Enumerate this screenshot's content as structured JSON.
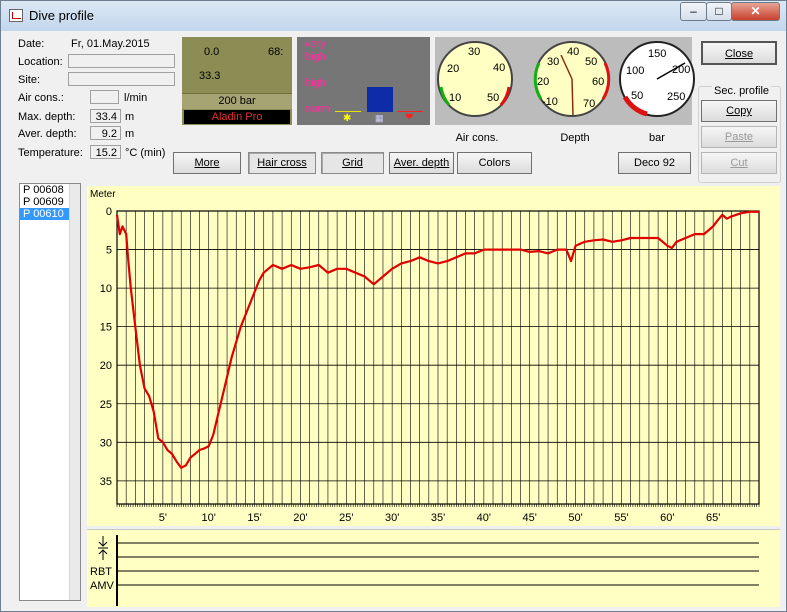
{
  "window": {
    "title": "Dive profile"
  },
  "info": {
    "date_label": "Date:",
    "date_value": "Fr, 01.May.2015",
    "location_label": "Location:",
    "location_value": "",
    "site_label": "Site:",
    "site_value": "",
    "aircons_label": "Air cons.:",
    "aircons_value": "",
    "aircons_unit": "l/min",
    "maxdepth_label": "Max. depth:",
    "maxdepth_value": "33.4",
    "maxdepth_unit": "m",
    "averdepth_label": "Aver. depth:",
    "averdepth_value": "9.2",
    "averdepth_unit": "m",
    "temp_label": "Temperature:",
    "temp_value": "15.2",
    "temp_unit": "°C  (min)"
  },
  "lcd": {
    "left": "0.0",
    "right": "68:",
    "depth": "33.3",
    "pressure": "200 bar",
    "model": "Aladin Pro"
  },
  "workload": {
    "very": "very",
    "high_1": "high",
    "high_2": "high",
    "norm": "norm",
    "level_color": "#0e2ca8"
  },
  "gauges": [
    {
      "name": "Air cons.",
      "ticks": [
        "10",
        "20",
        "30",
        "40",
        "50"
      ]
    },
    {
      "name": "Depth",
      "ticks": [
        "-10",
        "20",
        "30",
        "40",
        "50",
        "60",
        "70"
      ]
    },
    {
      "name": "bar",
      "ticks": [
        "50",
        "100",
        "150",
        "200",
        "250"
      ]
    }
  ],
  "buttons": {
    "more": "More",
    "haircross": "Hair cross",
    "grid": "Grid",
    "averdepth": "Aver. depth",
    "colors": "Colors",
    "deco": "Deco 92",
    "close": "Close",
    "copy": "Copy",
    "paste": "Paste",
    "cut": "Cut"
  },
  "secprofile": {
    "label": "Sec. profile"
  },
  "profiles": [
    "P 00608",
    "P 00609",
    "P 00610"
  ],
  "selected_profile": 2,
  "bottom_labels": [
    "RBT",
    "AMV"
  ],
  "colors": {
    "profile_line": "#e00000",
    "chart_bg": "#ffffc4",
    "accent": "#3399ff"
  },
  "chart_data": {
    "type": "line",
    "ylabel": "Meter",
    "y_inverted": true,
    "ylim": [
      0,
      38
    ],
    "xlim": [
      0,
      70
    ],
    "y_ticks": [
      "0",
      "5",
      "10",
      "15",
      "20",
      "25",
      "30",
      "35"
    ],
    "x_ticks": [
      "5'",
      "10'",
      "15'",
      "20'",
      "25'",
      "30'",
      "35'",
      "40'",
      "45'",
      "50'",
      "55'",
      "60'",
      "65'"
    ],
    "x_tick_values": [
      5,
      10,
      15,
      20,
      25,
      30,
      35,
      40,
      45,
      50,
      55,
      60,
      65
    ],
    "grid": true,
    "series": [
      {
        "values_x": [
          0,
          0.3,
          0.6,
          1,
          1.2,
          1.5,
          2,
          2.5,
          3,
          3.5,
          4,
          4.5,
          5,
          5.5,
          6,
          6.5,
          7,
          7.5,
          8,
          8.5,
          9,
          9.5,
          10,
          10.5,
          11,
          11.5,
          12,
          12.5,
          13,
          13.5,
          14,
          14.5,
          15,
          15.5,
          16,
          16.5,
          17,
          18,
          19,
          20,
          21,
          22,
          23,
          24,
          25,
          26,
          27,
          28,
          29,
          30,
          31,
          32,
          33,
          34,
          35,
          36,
          37,
          38,
          39,
          40,
          41,
          42,
          43,
          44,
          45,
          46,
          47,
          48,
          49,
          49.5,
          50,
          51,
          52,
          53,
          54,
          55,
          56,
          57,
          58,
          59,
          60,
          60.5,
          61,
          62,
          63,
          64,
          65,
          65.5,
          66,
          66.5,
          67,
          68,
          69,
          70
        ],
        "values_y": [
          0.5,
          3,
          2,
          3,
          6,
          10,
          15,
          20,
          23,
          24,
          26,
          29.5,
          30,
          31,
          31.5,
          32.5,
          33.3,
          33,
          32,
          31.5,
          31,
          30.8,
          30.5,
          29,
          26.5,
          24,
          21.5,
          19,
          17,
          15,
          13.5,
          12,
          10.5,
          9,
          8,
          7.5,
          7,
          7.5,
          7,
          7.5,
          7.3,
          7,
          8,
          7.5,
          7.5,
          8,
          8.5,
          9.5,
          8.5,
          7.5,
          6.8,
          6.5,
          6,
          6.5,
          6.8,
          6.5,
          6,
          5.5,
          5.5,
          5,
          5,
          5,
          5,
          5,
          5.3,
          5.2,
          5.5,
          5,
          5,
          6.5,
          4.5,
          4,
          3.8,
          3.7,
          4,
          3.8,
          3.5,
          3.5,
          3.5,
          3.5,
          4.5,
          4.8,
          4,
          3.5,
          3,
          3,
          2,
          1.2,
          0.5,
          1,
          0.7,
          0.3,
          0.1,
          0.1
        ]
      }
    ]
  }
}
